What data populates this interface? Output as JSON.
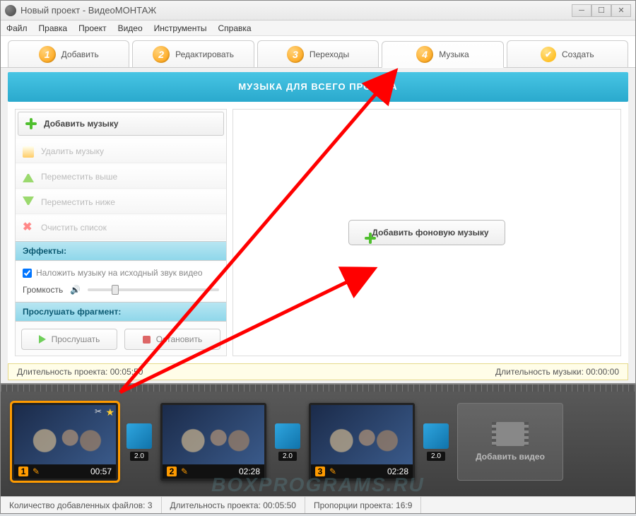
{
  "window": {
    "title": "Новый проект - ВидеоМОНТАЖ"
  },
  "menu": {
    "file": "Файл",
    "edit": "Правка",
    "project": "Проект",
    "video": "Видео",
    "tools": "Инструменты",
    "help": "Справка"
  },
  "tabs": {
    "add": "Добавить",
    "edit": "Редактировать",
    "transitions": "Переходы",
    "music": "Музыка",
    "create": "Создать"
  },
  "banner": "МУЗЫКА ДЛЯ ВСЕГО ПРОЕКТА",
  "sidebar": {
    "add_music": "Добавить музыку",
    "delete_music": "Удалить музыку",
    "move_up": "Переместить выше",
    "move_down": "Переместить ниже",
    "clear_list": "Очистить список",
    "effects_head": "Эффекты:",
    "overlay_cb": "Наложить музыку на исходный звук видео",
    "volume_label": "Громкость",
    "listen_head": "Прослушать фрагмент:",
    "play": "Прослушать",
    "stop": "Остановить"
  },
  "main": {
    "add_bg_music": "Добавить фоновую музыку"
  },
  "duration": {
    "project_label": "Длительность проекта:",
    "project_value": "00:05:50",
    "music_label": "Длительность музыки:",
    "music_value": "00:00:00"
  },
  "timeline": {
    "clips": [
      {
        "n": "1",
        "time": "00:57"
      },
      {
        "n": "2",
        "time": "02:28"
      },
      {
        "n": "3",
        "time": "02:28"
      }
    ],
    "transition_label": "2.0",
    "add_video": "Добавить видео"
  },
  "status": {
    "files_label": "Количество добавленных файлов:",
    "files_value": "3",
    "dur_label": "Длительность проекта:",
    "dur_value": "00:05:50",
    "ratio_label": "Пропорции проекта:",
    "ratio_value": "16:9"
  },
  "watermark": "BOXPROGRAMS.RU"
}
